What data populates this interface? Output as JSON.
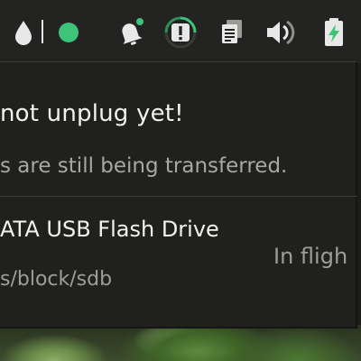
{
  "tray": {
    "icons": [
      {
        "name": "water-drop-icon",
        "color": "#e8e8e8"
      },
      {
        "name": "status-dot-icon",
        "color": "#3fc27a"
      },
      {
        "name": "notification-bell-icon",
        "color": "#e8e8e8",
        "badge_color": "#3fc27a"
      },
      {
        "name": "device-notifier-icon",
        "color": "#e8e8e8",
        "ring_color": "#3fc27a"
      },
      {
        "name": "clipboard-icon",
        "color": "#e8e8e8"
      },
      {
        "name": "volume-icon",
        "color": "#e8e8e8"
      },
      {
        "name": "battery-charging-icon",
        "color": "#e8e8e8",
        "bolt_color": "#3fc27a"
      }
    ]
  },
  "popup": {
    "headline": "not unplug yet!",
    "subtext": "s are still being transferred.",
    "device": {
      "name": "ATA USB Flash Drive",
      "path": "s/block/sdb",
      "status": "In fligh"
    }
  }
}
